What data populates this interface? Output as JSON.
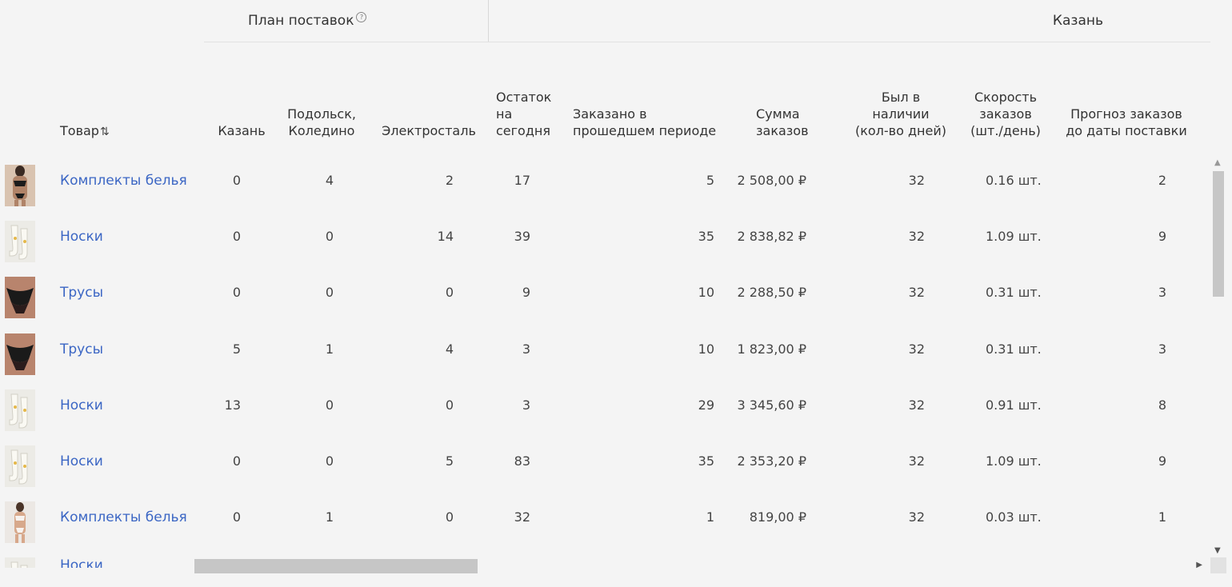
{
  "groups": {
    "plan": "План поставок",
    "city": "Казань"
  },
  "headers": {
    "product": "Товар",
    "kazan": "Казань",
    "podolsk_1": "Подольск,",
    "podolsk_2": "Коледино",
    "elektrostal": "Электросталь",
    "stock_1": "Остаток",
    "stock_2": "на",
    "stock_3": "сегодня",
    "ordered_1": "Заказано в",
    "ordered_2": "прошедшем периоде",
    "sum_1": "Сумма",
    "sum_2": "заказов",
    "avail_1": "Был в",
    "avail_2": "наличии",
    "avail_3": "(кол-во дней)",
    "speed_1": "Скорость",
    "speed_2": "заказов",
    "speed_3": "(шт./день)",
    "forecast_1": "Прогноз заказов",
    "forecast_2": "до даты поставки"
  },
  "rows": [
    {
      "product": "Комплекты белья",
      "thumb": "lingerie-set",
      "kazan": "0",
      "podolsk": "4",
      "elektrostal": "2",
      "stock": "17",
      "ordered": "5",
      "sum": "2 508,00 ₽",
      "days": "32",
      "speed": "0.16 шт.",
      "forecast": "2"
    },
    {
      "product": "Носки",
      "thumb": "socks",
      "kazan": "0",
      "podolsk": "0",
      "elektrostal": "14",
      "stock": "39",
      "ordered": "35",
      "sum": "2 838,82 ₽",
      "days": "32",
      "speed": "1.09 шт.",
      "forecast": "9"
    },
    {
      "product": "Трусы",
      "thumb": "panties",
      "kazan": "0",
      "podolsk": "0",
      "elektrostal": "0",
      "stock": "9",
      "ordered": "10",
      "sum": "2 288,50 ₽",
      "days": "32",
      "speed": "0.31 шт.",
      "forecast": "3"
    },
    {
      "product": "Трусы",
      "thumb": "panties",
      "kazan": "5",
      "podolsk": "1",
      "elektrostal": "4",
      "stock": "3",
      "ordered": "10",
      "sum": "1 823,00 ₽",
      "days": "32",
      "speed": "0.31 шт.",
      "forecast": "3"
    },
    {
      "product": "Носки",
      "thumb": "socks",
      "kazan": "13",
      "podolsk": "0",
      "elektrostal": "0",
      "stock": "3",
      "ordered": "29",
      "sum": "3 345,60 ₽",
      "days": "32",
      "speed": "0.91 шт.",
      "forecast": "8"
    },
    {
      "product": "Носки",
      "thumb": "socks",
      "kazan": "0",
      "podolsk": "0",
      "elektrostal": "5",
      "stock": "83",
      "ordered": "35",
      "sum": "2 353,20 ₽",
      "days": "32",
      "speed": "1.09 шт.",
      "forecast": "9"
    },
    {
      "product": "Комплекты белья",
      "thumb": "lingerie-set-white",
      "kazan": "0",
      "podolsk": "1",
      "elektrostal": "0",
      "stock": "32",
      "ordered": "1",
      "sum": "819,00 ₽",
      "days": "32",
      "speed": "0.03 шт.",
      "forecast": "1"
    },
    {
      "product": "Носки",
      "thumb": "socks",
      "kazan": "",
      "podolsk": "",
      "elektrostal": "",
      "stock": "",
      "ordered": "",
      "sum": "",
      "days": "",
      "speed": "",
      "forecast": ""
    }
  ]
}
